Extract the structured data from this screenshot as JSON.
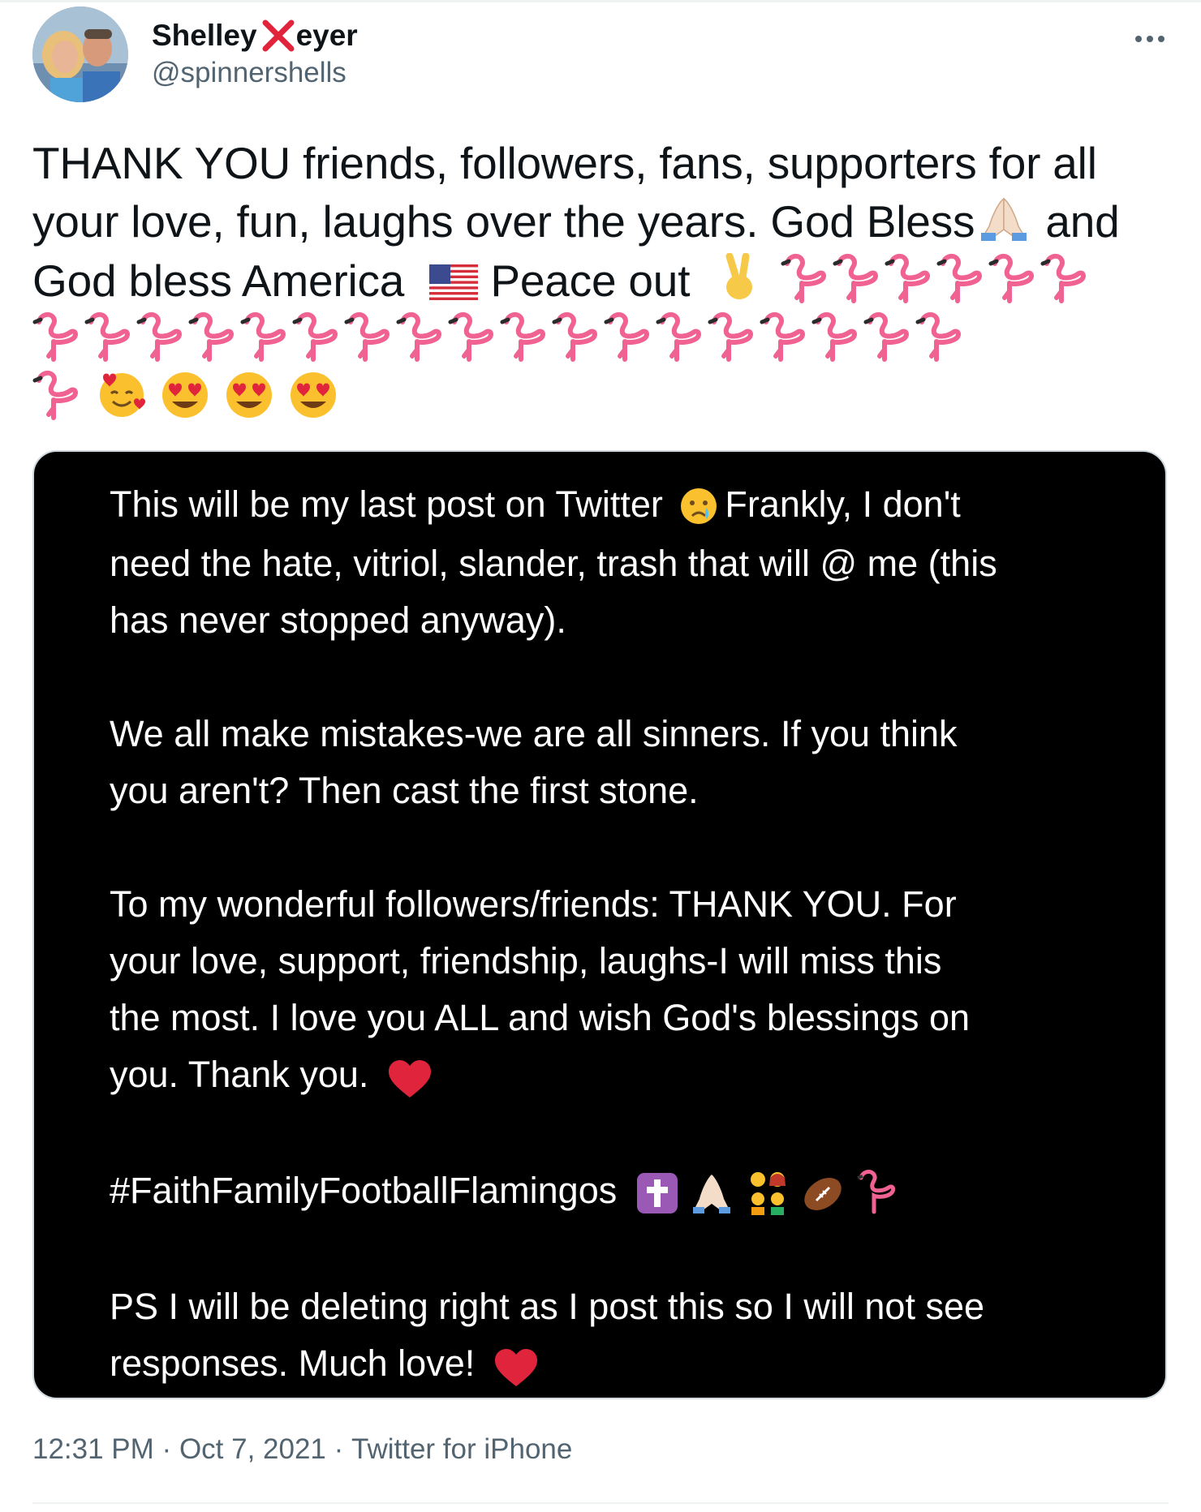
{
  "author": {
    "name_first": "Shelley",
    "name_last": "eyer",
    "handle": "@spinnershells",
    "avatar_icon": "couple-photo-avatar",
    "name_emoji": "cross-mark-emoji"
  },
  "tweet": {
    "line1": "THANK YOU friends, followers, fans, supporters for all",
    "line2_a": "your love, fun, laughs over the years. God Bless",
    "line2_b": "and",
    "line3_a": "God bless America",
    "line3_b": "Peace out",
    "flamingo_count_line3": 6,
    "flamingo_count_line4": 18,
    "flamingo_count_line5": 1,
    "trailing_emojis": [
      "smiling-face-with-hearts-emoji",
      "heart-eyes-emoji",
      "heart-eyes-emoji",
      "heart-eyes-emoji"
    ]
  },
  "card": {
    "p1_line1_a": "This will be my last post on Twitter",
    "p1_line1_b": "Frankly, I don't",
    "p1_line2": "need the hate, vitriol, slander, trash that will @ me (this",
    "p1_line3": "has never stopped anyway).",
    "p2_line1": "We all make mistakes-we are all sinners. If you think",
    "p2_line2": "you aren't? Then cast the first stone.",
    "p3_line1": "To my wonderful followers/friends: THANK YOU. For",
    "p3_line2": "your love, support, friendship, laughs-I will miss this",
    "p3_line3": "the most. I love you ALL and wish God's blessings on",
    "p3_line4": "you. Thank you.",
    "hashtag": "#FaithFamilyFootballFlamingos",
    "ps_line1": "PS I will be deleting right as I post this so I will not see",
    "ps_line2": "responses. Much love!"
  },
  "footer": {
    "time": "12:31 PM",
    "sep1": "·",
    "date": "Oct 7, 2021",
    "sep2": "·",
    "source": "Twitter for iPhone"
  },
  "colors": {
    "text_primary": "#0f1419",
    "text_secondary": "#536471",
    "card_bg": "#000000",
    "heart_red": "#e0243c",
    "flamingo_pink": "#f06292"
  }
}
